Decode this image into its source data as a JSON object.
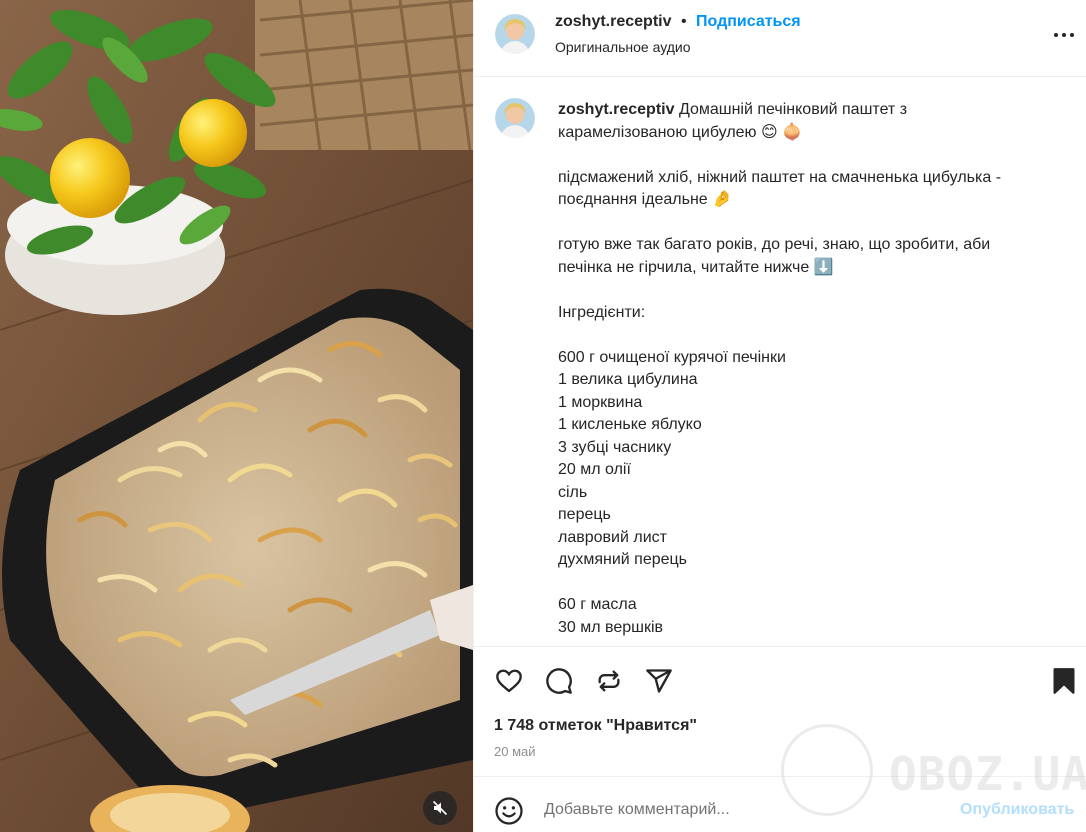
{
  "header": {
    "username": "zoshyt.receptiv",
    "separator": "•",
    "follow_label": "Подписаться",
    "audio_label": "Оригинальное аудио"
  },
  "caption": {
    "username": "zoshyt.receptiv",
    "lines": [
      "Домашній печінковий паштет з",
      "карамелізованою цибулею 😊 🧅",
      "",
      "підсмажений хліб, ніжний паштет на смачненька цибулька -",
      "поєднання ідеальне 🤌",
      "",
      "готую вже так багато років, до речі, знаю, що зробити, аби",
      "печінка не гірчила, читайте нижче ⬇️",
      "",
      "Інгредієнти:",
      "",
      "600 г очищеної курячої печінки",
      "1 велика цибулина",
      "1 морквина",
      "1 кисленьке яблуко",
      "3 зубці часнику",
      "20 мл олії",
      "сіль",
      "перець",
      "лавровий лист",
      "духмяний перець",
      "",
      "60 г масла",
      "30 мл вершків"
    ]
  },
  "stats": {
    "likes": "1 748 отметок \"Нравится\"",
    "date": "20 май"
  },
  "comment": {
    "placeholder": "Добавьте комментарий...",
    "publish_label": "Опубликовать"
  },
  "watermark": {
    "text": "OBOZ.UA"
  },
  "colors": {
    "accent": "#0095f6",
    "publish_disabled": "#b2dffc",
    "text": "#262626",
    "muted": "#8e8e8e",
    "divider": "#efefef"
  },
  "icons": [
    "more-options-icon",
    "like-heart-icon",
    "comment-icon",
    "repost-icon",
    "share-icon",
    "save-bookmark-icon",
    "emoji-icon",
    "muted-speaker-icon"
  ]
}
